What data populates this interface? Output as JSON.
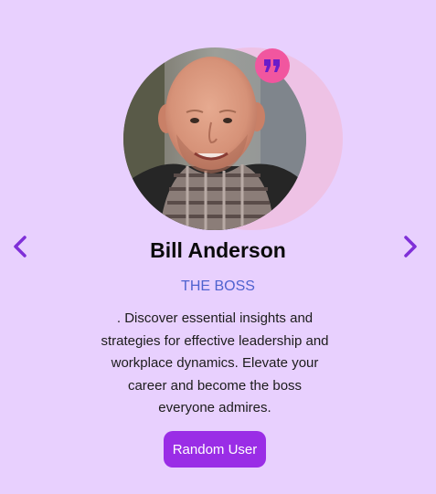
{
  "person": {
    "name": "Bill Anderson",
    "job": "THE BOSS",
    "info": ". Discover essential insights and strategies for effective leadership and workplace dynamics. Elevate your career and become the boss everyone admires."
  },
  "controls": {
    "prev_icon": "chevron-left-icon",
    "next_icon": "chevron-right-icon",
    "random_label": "Random User"
  },
  "badge": {
    "icon": "quote-icon"
  },
  "colors": {
    "background": "#e8d0fe",
    "accent": "#9a2de6",
    "job_title": "#4f62cf",
    "quote_badge": "#f1569f",
    "bg_circle": "#eec2e5"
  }
}
